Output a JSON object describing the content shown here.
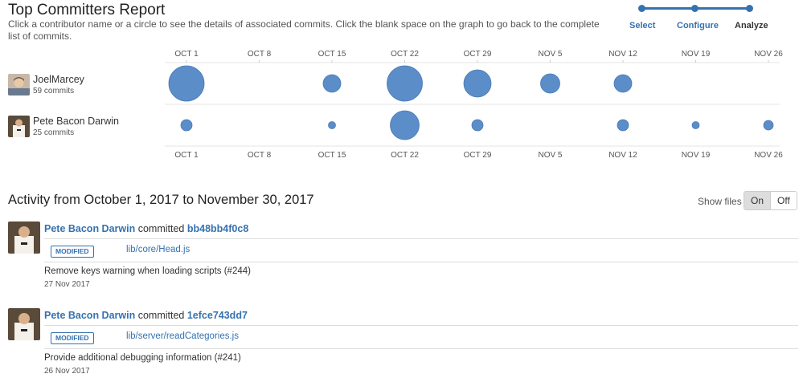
{
  "header": {
    "title": "Top Committers Report",
    "subtitle": "Click a contributor name or a circle to see the details of associated commits. Click the blank space on the graph to go back to the complete list of commits."
  },
  "wizard": {
    "steps": [
      {
        "label": "Select",
        "state": "done"
      },
      {
        "label": "Configure",
        "state": "done"
      },
      {
        "label": "Analyze",
        "state": "current"
      }
    ],
    "accent": "#3572b0"
  },
  "chart_data": {
    "type": "scatter",
    "x_ticks": [
      "OCT 1",
      "OCT 8",
      "OCT 15",
      "OCT 22",
      "OCT 29",
      "NOV 5",
      "NOV 12",
      "NOV 19",
      "NOV 26"
    ],
    "bubble_color": "#5b8dc9",
    "series": [
      {
        "name": "JoelMarcey",
        "commits_label": "59 commits",
        "avatar_icon": "user-avatar-icon",
        "bubble_radius": [
          22,
          0,
          11,
          22,
          17,
          12,
          11,
          0,
          0
        ]
      },
      {
        "name": "Pete Bacon Darwin",
        "commits_label": "25 commits",
        "avatar_icon": "user-avatar-icon",
        "bubble_radius": [
          7,
          0,
          4.5,
          18,
          7,
          0,
          7,
          4.5,
          6
        ]
      }
    ]
  },
  "activity": {
    "title": "Activity from October 1, 2017 to November 30, 2017",
    "show_files_label": "Show files",
    "toggle_on": "On",
    "toggle_off": "Off",
    "commits": [
      {
        "author": "Pete Bacon Darwin",
        "verb": "committed",
        "hash": "bb48bb4f0c8",
        "status": "MODIFIED",
        "file": "lib/core/Head.js",
        "message": "Remove keys warning when loading scripts (#244)",
        "date": "27 Nov 2017"
      },
      {
        "author": "Pete Bacon Darwin",
        "verb": "committed",
        "hash": "1efce743dd7",
        "status": "MODIFIED",
        "file": "lib/server/readCategories.js",
        "message": "Provide additional debugging information (#241)",
        "date": "26 Nov 2017"
      }
    ]
  }
}
